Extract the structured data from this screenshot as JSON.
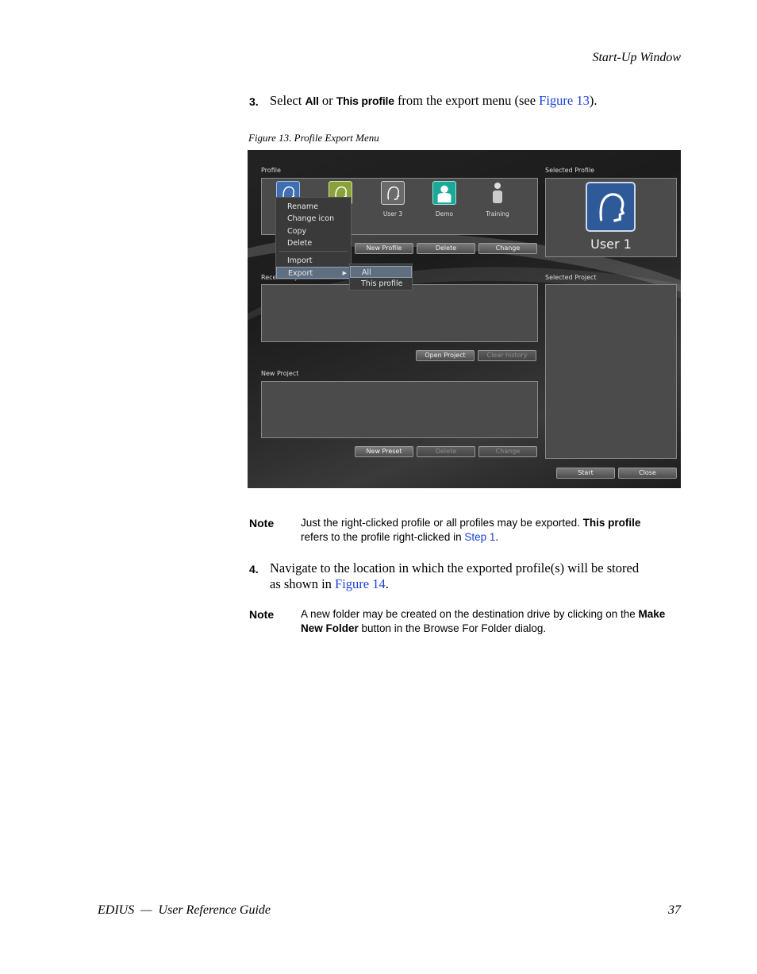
{
  "header": {
    "section_title": "Start-Up Window"
  },
  "step3": {
    "number": "3.",
    "text_select": "Select ",
    "opt_all": "All",
    "text_or": " or ",
    "opt_this_profile": "This profile",
    "text_rest": " from the export menu (see ",
    "link": "Figure 13",
    "text_end": ")."
  },
  "figure": {
    "caption": "Figure 13.  Profile Export Menu",
    "screen": {
      "profile_label": "Profile",
      "selected_profile_label": "Selected Profile",
      "recent_project_label": "Recent Project",
      "selected_project_label": "Selected Project",
      "new_project_label": "New Project",
      "profiles": [
        "User 3",
        "Demo",
        "Training"
      ],
      "selected_user": "User 1",
      "profile_buttons": {
        "new": "New Profile",
        "delete": "Delete",
        "change": "Change"
      },
      "recent_buttons": {
        "open": "Open Project",
        "clear": "Clear history"
      },
      "new_project_buttons": {
        "new": "New Preset",
        "delete": "Delete",
        "change": "Change"
      },
      "bottom_buttons": {
        "start": "Start",
        "close": "Close"
      },
      "context_menu": {
        "rename": "Rename",
        "change_icon": "Change icon",
        "copy": "Copy",
        "delete": "Delete",
        "import": "Import",
        "export": "Export"
      },
      "submenu": {
        "all": "All",
        "this_profile": "This profile"
      }
    }
  },
  "note1": {
    "label": "Note",
    "line1_a": "Just the right-clicked profile or all profiles may be exported. ",
    "line1_bold": "This profile",
    "line2_a": "refers to the profile right-clicked in ",
    "line2_link": "Step 1",
    "line2_end": "."
  },
  "step4": {
    "number": "4.",
    "line1": "Navigate to the location in which the exported profile(s) will be stored",
    "line2_a": "as shown in ",
    "line2_link": "Figure 14",
    "line2_end": "."
  },
  "note2": {
    "label": "Note",
    "line1_a": "A new folder may be created on the destination drive by clicking on the ",
    "line1_bold": "Make",
    "line2_bold": "New Folder",
    "line2_a": " button in the Browse For Folder dialog."
  },
  "footer": {
    "guide": "EDIUS  —  User Reference Guide",
    "page": "37"
  }
}
